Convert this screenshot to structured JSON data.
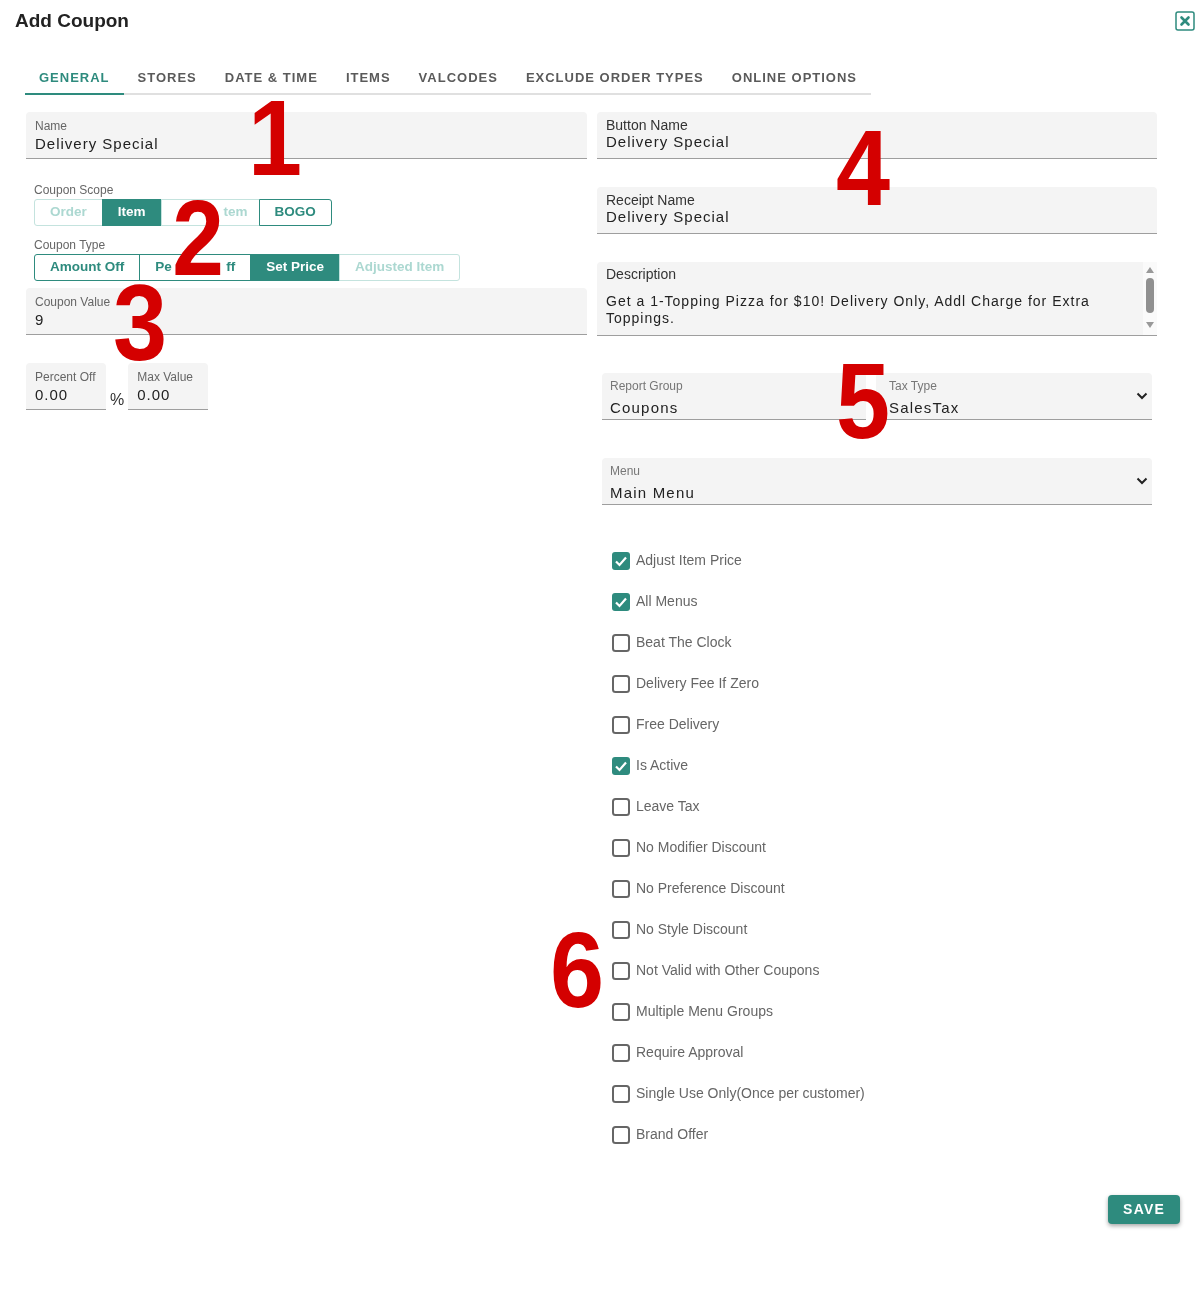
{
  "dialog": {
    "title": "Add Coupon"
  },
  "tabs": [
    {
      "label": "GENERAL",
      "selected": true
    },
    {
      "label": "STORES",
      "selected": false
    },
    {
      "label": "DATE & TIME",
      "selected": false
    },
    {
      "label": "ITEMS",
      "selected": false
    },
    {
      "label": "VALCODES",
      "selected": false
    },
    {
      "label": "EXCLUDE ORDER TYPES",
      "selected": false
    },
    {
      "label": "ONLINE OPTIONS",
      "selected": false
    }
  ],
  "name": {
    "label": "Name",
    "value": "Delivery Special"
  },
  "coupon_scope": {
    "label": "Coupon Scope",
    "options": [
      {
        "label": "Order",
        "selected": false,
        "disabled": true
      },
      {
        "label": "Item",
        "selected": true,
        "disabled": false
      },
      {
        "fragments": [
          "tem"
        ],
        "selected": false,
        "disabled": true
      },
      {
        "label": "BOGO",
        "selected": false,
        "disabled": false
      }
    ]
  },
  "coupon_type": {
    "label": "Coupon Type",
    "options": [
      {
        "label": "Amount Off",
        "selected": false,
        "disabled": false
      },
      {
        "fragments": [
          "Pe",
          "ff"
        ],
        "selected": false,
        "disabled": false
      },
      {
        "label": "Set Price",
        "selected": true,
        "disabled": false
      },
      {
        "label": "Adjusted Item",
        "selected": false,
        "disabled": true
      }
    ]
  },
  "coupon_value": {
    "label": "Coupon Value",
    "value": "9"
  },
  "percent_off": {
    "label": "Percent Off",
    "value": "0.00",
    "unit": "%"
  },
  "max_value": {
    "label": "Max Value",
    "value": "0.00"
  },
  "button_name": {
    "label": "Button Name",
    "value": "Delivery Special"
  },
  "receipt_name": {
    "label": "Receipt Name",
    "value": "Delivery Special"
  },
  "description": {
    "label": "Description",
    "value": "Get a 1-Topping Pizza for $10! Delivery Only, Addl Charge for Extra Toppings."
  },
  "report_group": {
    "label": "Report Group",
    "value": "Coupons"
  },
  "tax_type": {
    "label": "Tax Type",
    "value": "SalesTax"
  },
  "menu": {
    "label": "Menu",
    "value": "Main Menu"
  },
  "options": [
    {
      "label": "Adjust Item Price",
      "checked": true
    },
    {
      "label": "All Menus",
      "checked": true
    },
    {
      "label": "Beat The Clock",
      "checked": false
    },
    {
      "label": "Delivery Fee If Zero",
      "checked": false
    },
    {
      "label": "Free Delivery",
      "checked": false
    },
    {
      "label": "Is Active",
      "checked": true
    },
    {
      "label": "Leave Tax",
      "checked": false
    },
    {
      "label": "No Modifier Discount",
      "checked": false
    },
    {
      "label": "No Preference Discount",
      "checked": false
    },
    {
      "label": "No Style Discount",
      "checked": false
    },
    {
      "label": "Not Valid with Other Coupons",
      "checked": false
    },
    {
      "label": "Multiple Menu Groups",
      "checked": false
    },
    {
      "label": "Require Approval",
      "checked": false
    },
    {
      "label": "Single Use Only(Once per customer)",
      "checked": false
    },
    {
      "label": "Brand Offer",
      "checked": false
    }
  ],
  "save_button": {
    "label": "SAVE"
  },
  "annotations": [
    "1",
    "2",
    "3",
    "4",
    "5",
    "6"
  ]
}
